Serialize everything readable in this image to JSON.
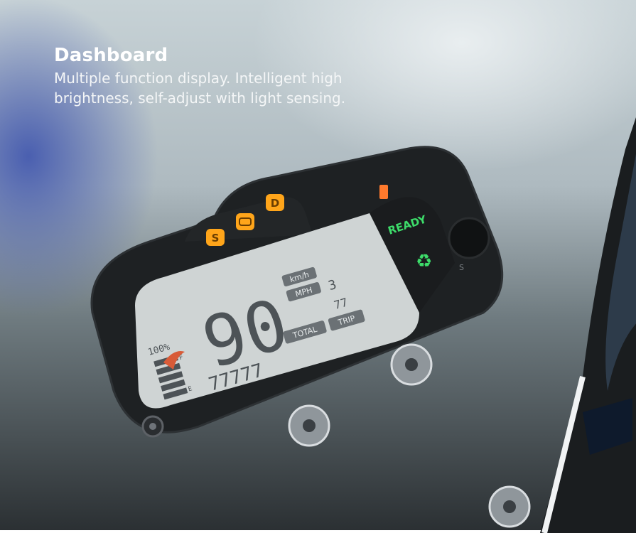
{
  "caption": {
    "title": "Dashboard",
    "description_line1": "Multiple function display. Intelligent high",
    "description_line2": "brightness, self-adjust with light sensing."
  },
  "display": {
    "speed": "90",
    "unit_kmh": "km/h",
    "unit_mph": "MPH",
    "gear": "3",
    "odometer": "77777",
    "trip_value": "77",
    "tab_total": "TOTAL",
    "tab_trip": "TRIP",
    "ready": "READY",
    "battery_label": "100%",
    "fuel_high": "F",
    "fuel_low": "E"
  },
  "indicators": {
    "sport": "S",
    "drive": "D"
  },
  "housing": {
    "mode_mark": "S"
  },
  "colors": {
    "amber": "#ffa51a",
    "ready_green": "#3ddc6a",
    "lcd_bg": "#cfd4d4",
    "lcd_ink": "#4d5357"
  }
}
